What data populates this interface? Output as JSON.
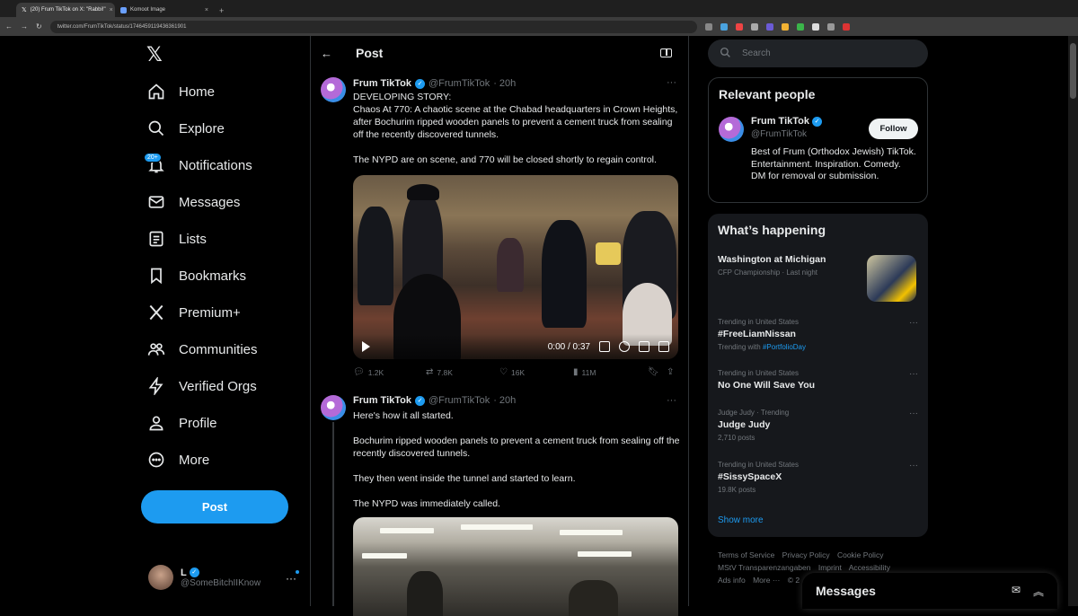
{
  "browser": {
    "tabs": [
      {
        "label": "(20) Frum TikTok on X: \"Rabbi!\"",
        "active": true
      },
      {
        "label": "Komoot Image",
        "active": false
      }
    ],
    "url": "twitter.com/FrumTikTok/status/1746459119436361901"
  },
  "nav": {
    "items": [
      "Home",
      "Explore",
      "Notifications",
      "Messages",
      "Lists",
      "Bookmarks",
      "Premium+",
      "Communities",
      "Verified Orgs",
      "Profile",
      "More"
    ],
    "notifications_badge": "20+",
    "post_label": "Post"
  },
  "me": {
    "name": "L",
    "handle": "@SomeBitchIIKnow"
  },
  "header": {
    "title": "Post"
  },
  "tweets": [
    {
      "name": "Frum TikTok",
      "handle": "@FrumTikTok",
      "time": "· 20h",
      "text": [
        "DEVELOPING STORY:",
        "Chaos At 770: A chaotic scene at the Chabad headquarters in Crown Heights, after Bochurim ripped wooden panels to prevent a cement truck from sealing off the recently discovered tunnels.",
        "The NYPD are on scene, and 770 will be closed shortly to regain control."
      ],
      "video_time": "0:00 / 0:37",
      "replies": "1.2K",
      "reposts": "7.8K",
      "likes": "16K",
      "views": "11M"
    },
    {
      "name": "Frum TikTok",
      "handle": "@FrumTikTok",
      "time": "· 20h",
      "text": [
        "Here's how it all started.",
        "Bochurim ripped wooden panels to prevent a cement truck from sealing off the recently discovered tunnels.",
        "They then went inside the tunnel and started to learn.",
        "The NYPD was immediately called."
      ]
    }
  ],
  "search": {
    "placeholder": "Search"
  },
  "relevant": {
    "title": "Relevant people",
    "name": "Frum TikTok",
    "handle": "@FrumTikTok",
    "follow_label": "Follow",
    "bio": "Best of Frum (Orthodox Jewish) TikTok. Entertainment. Inspiration. Comedy. DM for removal or submission."
  },
  "happening": {
    "title": "What’s happening",
    "featured": {
      "name": "Washington at Michigan",
      "meta": "CFP Championship · Last night"
    },
    "trends": [
      {
        "meta": "Trending in United States",
        "name": "#FreeLiamNissan",
        "sub_prefix": "Trending with",
        "sub_link": "#PortfolioDay"
      },
      {
        "meta": "Trending in United States",
        "name": "No One Will Save You"
      },
      {
        "meta": "Judge Judy · Trending",
        "name": "Judge Judy",
        "sub": "2,710 posts"
      },
      {
        "meta": "Trending in United States",
        "name": "#SissySpaceX",
        "sub": "19.8K posts"
      }
    ],
    "show_more": "Show more"
  },
  "footer": {
    "links": [
      "Terms of Service",
      "Privacy Policy",
      "Cookie Policy",
      "MStV Transparenzangaben",
      "Imprint",
      "Accessibility",
      "Ads info",
      "More ···",
      "© 2"
    ]
  },
  "messages_drawer": {
    "title": "Messages"
  }
}
